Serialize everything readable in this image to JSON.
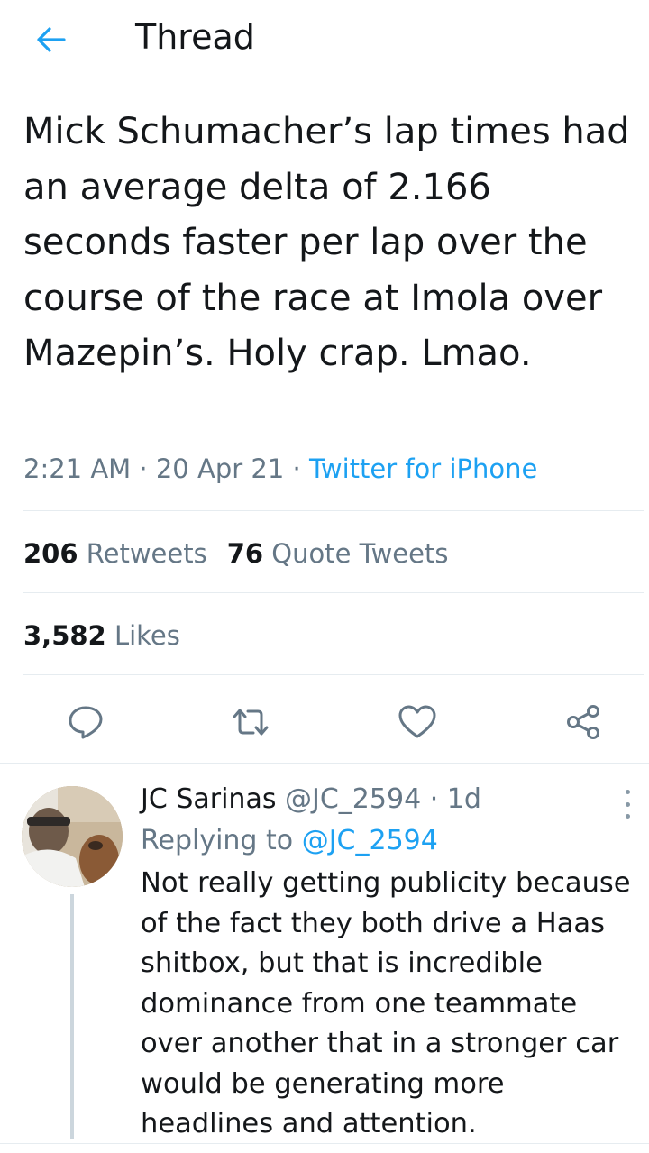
{
  "header": {
    "title": "Thread",
    "back_icon": "arrow-left-icon"
  },
  "tweet": {
    "text": "Mick Schumacher’s lap times had an average delta of 2.166 seconds faster per lap over the course of the race at Imola over Mazepin’s. Holy crap. Lmao.",
    "time": "2:21 AM",
    "date": "20 Apr 21",
    "source": "Twitter for iPhone",
    "retweets_count": "206",
    "retweets_label": "Retweets",
    "quotes_count": "76",
    "quotes_label": "Quote Tweets",
    "likes_count": "3,582",
    "likes_label": "Likes"
  },
  "actions": {
    "reply_icon": "reply-icon",
    "retweet_icon": "retweet-icon",
    "like_icon": "heart-icon",
    "share_icon": "share-icon"
  },
  "reply": {
    "name": "JC Sarinas",
    "handle": "@JC_2594",
    "age": "1d",
    "replying_prefix": "Replying to",
    "replying_to": "@JC_2594",
    "text": "Not really getting publicity because of the fact they both drive a Haas shitbox, but that is incredible dominance from one teammate over another that in a stronger car would be generating more headlines and attention."
  },
  "colors": {
    "accent": "#1da1f2",
    "muted": "#657786",
    "text": "#14171a",
    "divider": "#e6ecf0"
  }
}
